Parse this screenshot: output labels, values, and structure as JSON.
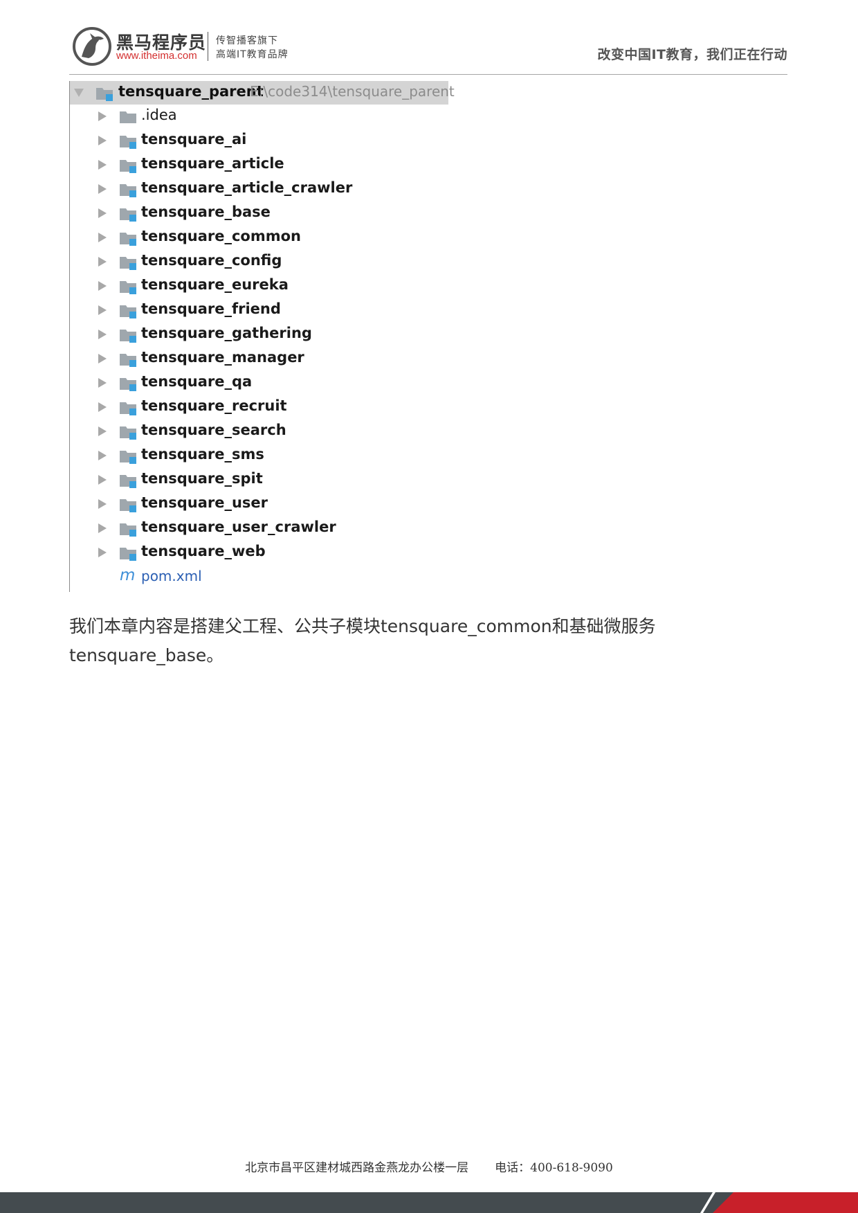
{
  "header": {
    "logo_name": "黑马程序员",
    "logo_url": "www.itheima.com",
    "logo_tag_line1": "传智播客旗下",
    "logo_tag_line2": "高端IT教育品牌",
    "slogan": "改变中国IT教育，我们正在行动"
  },
  "tree": {
    "root": {
      "name": "tensquare_parent",
      "path": "E:\\code314\\tensquare_parent"
    },
    "items": [
      {
        "label": ".idea",
        "bold": false
      },
      {
        "label": "tensquare_ai",
        "bold": true
      },
      {
        "label": "tensquare_article",
        "bold": true
      },
      {
        "label": "tensquare_article_crawler",
        "bold": true
      },
      {
        "label": "tensquare_base",
        "bold": true
      },
      {
        "label": "tensquare_common",
        "bold": true
      },
      {
        "label": "tensquare_config",
        "bold": true
      },
      {
        "label": "tensquare_eureka",
        "bold": true
      },
      {
        "label": "tensquare_friend",
        "bold": true
      },
      {
        "label": "tensquare_gathering",
        "bold": true
      },
      {
        "label": "tensquare_manager",
        "bold": true
      },
      {
        "label": "tensquare_qa",
        "bold": true
      },
      {
        "label": "tensquare_recruit",
        "bold": true
      },
      {
        "label": "tensquare_search",
        "bold": true
      },
      {
        "label": "tensquare_sms",
        "bold": true
      },
      {
        "label": "tensquare_spit",
        "bold": true
      },
      {
        "label": "tensquare_user",
        "bold": true
      },
      {
        "label": "tensquare_user_crawler",
        "bold": true
      },
      {
        "label": "tensquare_web",
        "bold": true
      }
    ],
    "pom": {
      "icon": "m",
      "label": "pom.xml"
    }
  },
  "body": {
    "line1": "我们本章内容是搭建父工程、公共子模块tensquare_common和基础微服务",
    "line2": "tensquare_base。"
  },
  "footer": {
    "address": "北京市昌平区建材城西路金燕龙办公楼一层",
    "phone": "电话：400-618-9090"
  },
  "colors": {
    "brand_red": "#d32f2f",
    "footer_band": "#444b4f",
    "footer_red": "#c8202a",
    "module_badge": "#3aa0dc",
    "folder_gray": "#9fa7ad"
  }
}
